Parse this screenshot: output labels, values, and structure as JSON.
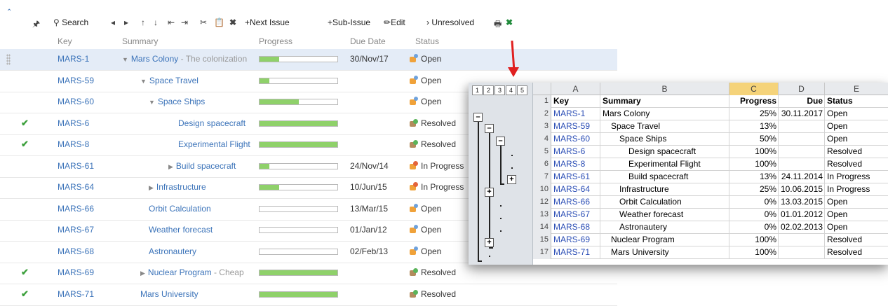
{
  "toolbar": {
    "search": "Search",
    "next_issue": "Next Issue",
    "sub_issue": "Sub-Issue",
    "edit": "Edit",
    "unresolved": "Unresolved"
  },
  "columns": {
    "key": "Key",
    "summary": "Summary",
    "progress": "Progress",
    "due": "Due Date",
    "status": "Status"
  },
  "rows": [
    {
      "key": "MARS-1",
      "summary": "Mars Colony",
      "desc": " - The colonization",
      "progress": 25,
      "due": "30/Nov/17",
      "status": "Open",
      "st": "open",
      "check": false,
      "tri": "down",
      "indent": 0,
      "selected": true
    },
    {
      "key": "MARS-59",
      "summary": "Space Travel",
      "desc": "",
      "progress": 13,
      "due": "",
      "status": "Open",
      "st": "open",
      "check": false,
      "tri": "down",
      "indent": 1
    },
    {
      "key": "MARS-60",
      "summary": "Space Ships",
      "desc": "",
      "progress": 50,
      "due": "",
      "status": "Open",
      "st": "open",
      "check": false,
      "tri": "down",
      "indent": 2
    },
    {
      "key": "MARS-6",
      "summary": "Design spacecraft",
      "desc": "",
      "progress": 100,
      "due": "",
      "status": "Resolved",
      "st": "resolved",
      "check": true,
      "tri": "",
      "indent": 3
    },
    {
      "key": "MARS-8",
      "summary": "Experimental Flight",
      "desc": "",
      "progress": 100,
      "due": "",
      "status": "Resolved",
      "st": "resolved",
      "check": true,
      "tri": "",
      "indent": 3
    },
    {
      "key": "MARS-61",
      "summary": "Build spacecraft",
      "desc": "",
      "progress": 13,
      "due": "24/Nov/14",
      "status": "In Progress",
      "st": "progress",
      "check": false,
      "tri": "right",
      "indent": 3
    },
    {
      "key": "MARS-64",
      "summary": "Infrastructure",
      "desc": "",
      "progress": 25,
      "due": "10/Jun/15",
      "status": "In Progress",
      "st": "progress",
      "check": false,
      "tri": "right",
      "indent": 2
    },
    {
      "key": "MARS-66",
      "summary": "Orbit Calculation",
      "desc": "",
      "progress": 0,
      "due": "13/Mar/15",
      "status": "Open",
      "st": "open",
      "check": false,
      "tri": "",
      "indent": 2
    },
    {
      "key": "MARS-67",
      "summary": "Weather forecast",
      "desc": "",
      "progress": 0,
      "due": "01/Jan/12",
      "status": "Open",
      "st": "open",
      "check": false,
      "tri": "",
      "indent": 2
    },
    {
      "key": "MARS-68",
      "summary": "Astronautery",
      "desc": "",
      "progress": 0,
      "due": "02/Feb/13",
      "status": "Open",
      "st": "open",
      "check": false,
      "tri": "",
      "indent": 2
    },
    {
      "key": "MARS-69",
      "summary": "Nuclear Program",
      "desc": " - Cheap",
      "progress": 100,
      "due": "",
      "status": "Resolved",
      "st": "resolved",
      "check": true,
      "tri": "right",
      "indent": 1
    },
    {
      "key": "MARS-71",
      "summary": "Mars University",
      "desc": "",
      "progress": 100,
      "due": "",
      "status": "Resolved",
      "st": "resolved",
      "check": true,
      "tri": "",
      "indent": 1
    }
  ],
  "excel": {
    "levels": [
      "1",
      "2",
      "3",
      "4",
      "5"
    ],
    "col_letters": [
      "A",
      "B",
      "C",
      "D",
      "E"
    ],
    "header": {
      "rn": "1",
      "key": "Key",
      "summary": "Summary",
      "progress": "Progress",
      "due": "Due",
      "status": "Status"
    },
    "rows": [
      {
        "rn": "2",
        "key": "MARS-1",
        "summary": "Mars Colony",
        "indent": 0,
        "progress": "25%",
        "due": "30.11.2017",
        "status": "Open"
      },
      {
        "rn": "3",
        "key": "MARS-59",
        "summary": "Space Travel",
        "indent": 1,
        "progress": "13%",
        "due": "",
        "status": "Open"
      },
      {
        "rn": "4",
        "key": "MARS-60",
        "summary": "Space Ships",
        "indent": 2,
        "progress": "50%",
        "due": "",
        "status": "Open"
      },
      {
        "rn": "5",
        "key": "MARS-6",
        "summary": "Design spacecraft",
        "indent": 3,
        "progress": "100%",
        "due": "",
        "status": "Resolved"
      },
      {
        "rn": "6",
        "key": "MARS-8",
        "summary": "Experimental Flight",
        "indent": 3,
        "progress": "100%",
        "due": "",
        "status": "Resolved"
      },
      {
        "rn": "7",
        "key": "MARS-61",
        "summary": "Build spacecraft",
        "indent": 3,
        "progress": "13%",
        "due": "24.11.2014",
        "status": "In Progress"
      },
      {
        "rn": "10",
        "key": "MARS-64",
        "summary": "Infrastructure",
        "indent": 2,
        "progress": "25%",
        "due": "10.06.2015",
        "status": "In Progress"
      },
      {
        "rn": "12",
        "key": "MARS-66",
        "summary": "Orbit Calculation",
        "indent": 2,
        "progress": "0%",
        "due": "13.03.2015",
        "status": "Open"
      },
      {
        "rn": "13",
        "key": "MARS-67",
        "summary": "Weather forecast",
        "indent": 2,
        "progress": "0%",
        "due": "01.01.2012",
        "status": "Open"
      },
      {
        "rn": "14",
        "key": "MARS-68",
        "summary": "Astronautery",
        "indent": 2,
        "progress": "0%",
        "due": "02.02.2013",
        "status": "Open"
      },
      {
        "rn": "15",
        "key": "MARS-69",
        "summary": "Nuclear Program",
        "indent": 1,
        "progress": "100%",
        "due": "",
        "status": "Resolved"
      },
      {
        "rn": "17",
        "key": "MARS-71",
        "summary": "Mars University",
        "indent": 1,
        "progress": "100%",
        "due": "",
        "status": "Resolved"
      }
    ]
  },
  "colors": {
    "link": "#3b73b9",
    "progress_fill": "#8fd16a",
    "arrow": "#e02020",
    "active_col": "#f5d37a"
  }
}
